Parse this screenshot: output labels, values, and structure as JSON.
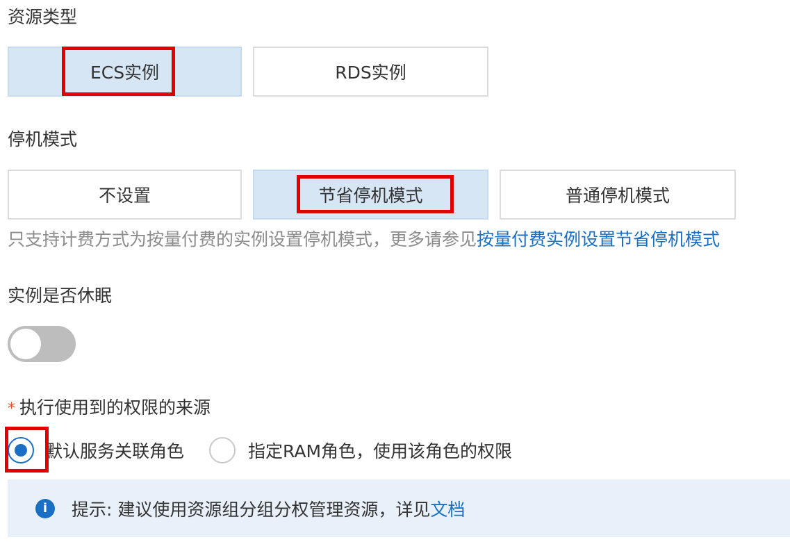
{
  "resource_type": {
    "label": "资源类型",
    "options": [
      "ECS实例",
      "RDS实例"
    ],
    "selected": "ECS实例"
  },
  "shutdown_mode": {
    "label": "停机模式",
    "options": [
      "不设置",
      "节省停机模式",
      "普通停机模式"
    ],
    "selected": "节省停机模式",
    "note_text": "只支持计费方式为按量付费的实例设置停机模式，更多请参见",
    "note_link": "按量付费实例设置节省停机模式"
  },
  "hibernate": {
    "label": "实例是否休眠",
    "enabled": false
  },
  "permission_source": {
    "required_mark": "*",
    "label": "执行使用到的权限的来源",
    "options": [
      "默认服务关联角色",
      "指定RAM角色，使用该角色的权限"
    ],
    "selected": "默认服务关联角色"
  },
  "tip": {
    "icon": "info-icon",
    "icon_glyph": "i",
    "text": "提示: 建议使用资源组分组分权管理资源，详见",
    "link": "文档"
  },
  "colors": {
    "accent": "#1a6fc5",
    "highlight_box": "#e00000",
    "selected_bg": "#d7e6f5",
    "required": "#e5502e"
  }
}
